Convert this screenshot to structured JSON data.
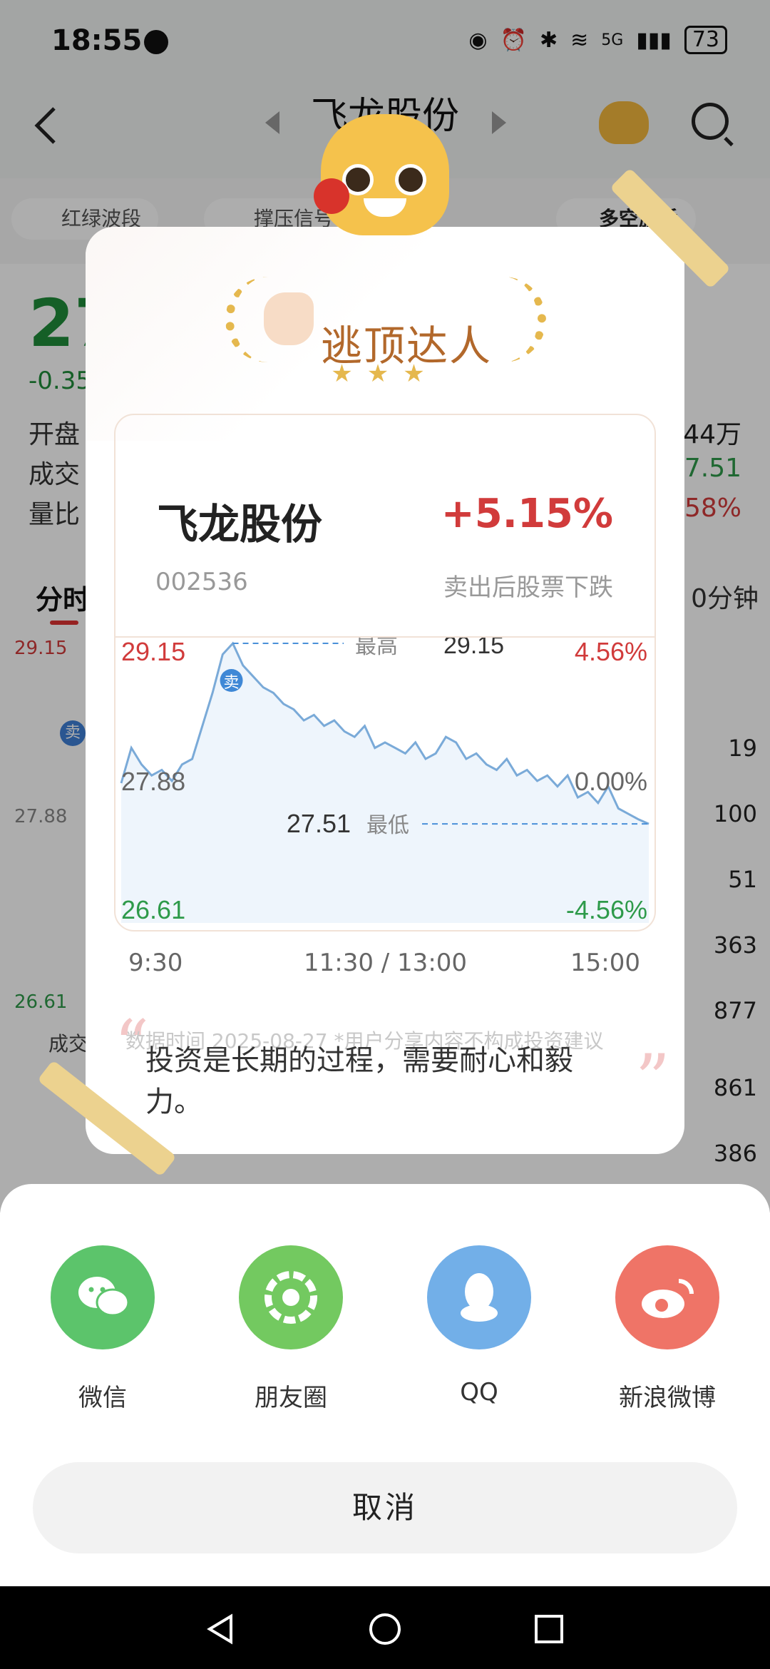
{
  "status": {
    "time": "18:55",
    "battery": "73",
    "network": "5G"
  },
  "header": {
    "title": "飞龙股份"
  },
  "tags": [
    "红绿波段",
    "撑压信号",
    "多空旗手"
  ],
  "quote": {
    "price_partial": "27",
    "change_partial": "-0.35",
    "row1_label": "开盘",
    "row2_label": "成交",
    "row3_label": "量比",
    "row1_right": "44万",
    "row2_right": "7.51",
    "row3_right": "58%"
  },
  "chart_tabs": {
    "active": "分时",
    "right": "0分钟"
  },
  "mini_chart": {
    "high_label": "29.15",
    "low_label": "26.61",
    "mid_label": "27.88",
    "sell_marker": "卖",
    "vol_label": "成交",
    "volumes": [
      "19",
      "100",
      "51",
      "363",
      "877",
      "861",
      "386"
    ]
  },
  "card": {
    "badge_title": "逃顶达人",
    "stock_name": "飞龙股份",
    "stock_code": "002536",
    "change_pct": "+5.15%",
    "change_desc": "卖出后股票下跌",
    "disclaimer": "数据时间 2025-08-27   *用户分享内容不构成投资建议",
    "motto": "投资是长期的过程，需要耐心和毅力。",
    "times": [
      "9:30",
      "11:30 / 13:00",
      "15:00"
    ]
  },
  "chart_data": {
    "type": "line",
    "title": "",
    "xlabel": "",
    "ylabel": "",
    "x_ticks": [
      "9:30",
      "11:30 / 13:00",
      "15:00"
    ],
    "y_left_ticks": [
      "29.15",
      "27.88",
      "26.61"
    ],
    "y_right_ticks": [
      "4.56%",
      "0.00%",
      "-4.56%"
    ],
    "ylim": [
      26.61,
      29.15
    ],
    "high": {
      "label": "最高",
      "value": "29.15"
    },
    "low": {
      "label": "最低",
      "value": "27.51"
    },
    "sell_marker": "卖",
    "series": [
      {
        "values": [
          27.88,
          28.2,
          28.05,
          27.95,
          28.0,
          27.9,
          28.05,
          28.1,
          28.4,
          28.7,
          29.05,
          29.15,
          28.95,
          28.85,
          28.75,
          28.7,
          28.6,
          28.55,
          28.45,
          28.5,
          28.4,
          28.45,
          28.35,
          28.3,
          28.4,
          28.2,
          28.25,
          28.2,
          28.15,
          28.25,
          28.1,
          28.15,
          28.3,
          28.25,
          28.1,
          28.15,
          28.05,
          28.0,
          28.1,
          27.95,
          28.0,
          27.9,
          27.95,
          27.85,
          27.95,
          27.75,
          27.8,
          27.7,
          27.85,
          27.65,
          27.6,
          27.55,
          27.51
        ]
      }
    ]
  },
  "share": {
    "items": [
      {
        "label": "微信",
        "color": "#5cc46b"
      },
      {
        "label": "朋友圈",
        "color": "#73c960"
      },
      {
        "label": "QQ",
        "color": "#72afe8"
      },
      {
        "label": "新浪微博",
        "color": "#ef7467"
      }
    ],
    "cancel": "取消"
  },
  "colors": {
    "up": "#d13b3b",
    "down": "#2e9a4a",
    "line": "#7aaad8",
    "fill": "#eef5fc",
    "accent": "#b2682b"
  }
}
